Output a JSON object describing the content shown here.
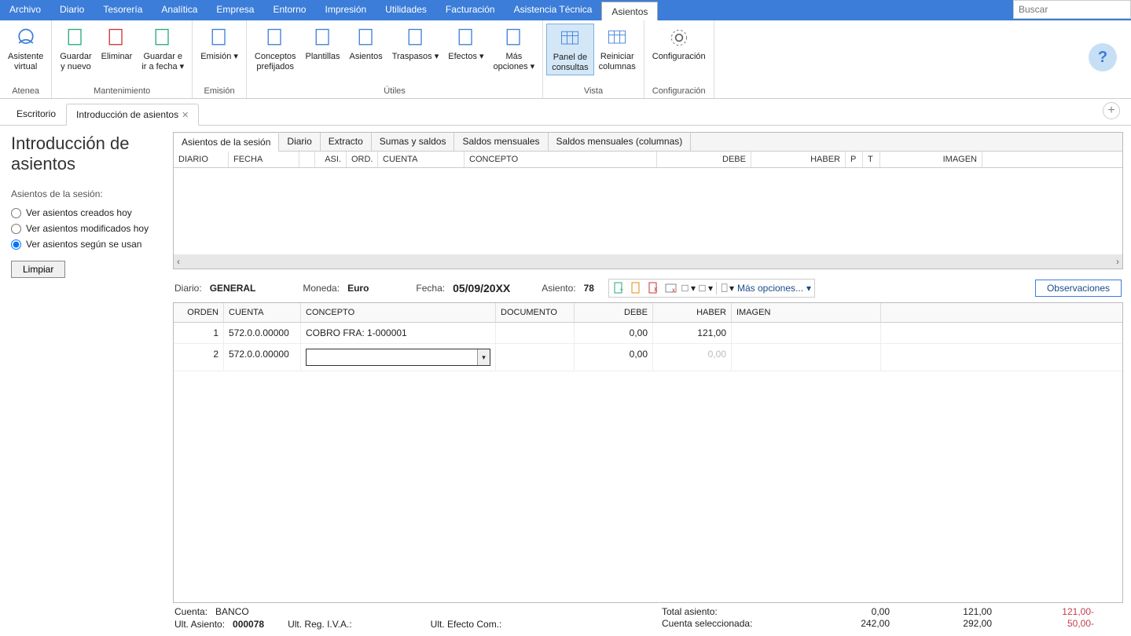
{
  "menubar": {
    "items": [
      "Archivo",
      "Diario",
      "Tesorería",
      "Analítica",
      "Empresa",
      "Entorno",
      "Impresión",
      "Utilidades",
      "Facturación",
      "Asistencia Técnica",
      "Asientos"
    ],
    "active_index": 10
  },
  "search": {
    "placeholder": "Buscar"
  },
  "ribbon": {
    "groups": [
      {
        "title": "Atenea",
        "buttons": [
          {
            "label": "Asistente\nvirtual",
            "name": "asistente-virtual-button"
          }
        ]
      },
      {
        "title": "Mantenimiento",
        "buttons": [
          {
            "label": "Guardar\ny nuevo",
            "name": "guardar-nuevo-button"
          },
          {
            "label": "Eliminar",
            "name": "eliminar-button"
          },
          {
            "label": "Guardar e\nir a fecha",
            "name": "guardar-ir-fecha-button",
            "dropdown": true
          }
        ]
      },
      {
        "title": "Emisión",
        "buttons": [
          {
            "label": "Emisión",
            "name": "emision-button",
            "dropdown": true
          }
        ]
      },
      {
        "title": "Útiles",
        "buttons": [
          {
            "label": "Conceptos\nprefijados",
            "name": "conceptos-prefijados-button"
          },
          {
            "label": "Plantillas",
            "name": "plantillas-button"
          },
          {
            "label": "Asientos",
            "name": "asientos-util-button"
          },
          {
            "label": "Traspasos",
            "name": "traspasos-button",
            "dropdown": true
          },
          {
            "label": "Efectos",
            "name": "efectos-button",
            "dropdown": true
          },
          {
            "label": "Más\nopciones",
            "name": "mas-opciones-ribbon-button",
            "dropdown": true
          }
        ]
      },
      {
        "title": "Vista",
        "buttons": [
          {
            "label": "Panel de\nconsultas",
            "name": "panel-consultas-button",
            "active": true
          },
          {
            "label": "Reiniciar\ncolumnas",
            "name": "reiniciar-columnas-button"
          }
        ]
      },
      {
        "title": "Configuración",
        "buttons": [
          {
            "label": "Configuración",
            "name": "configuracion-button"
          }
        ]
      }
    ]
  },
  "tabs": {
    "items": [
      {
        "label": "Escritorio",
        "closable": false
      },
      {
        "label": "Introducción de asientos",
        "closable": true,
        "active": true
      }
    ]
  },
  "page": {
    "title": "Introducción de asientos"
  },
  "sidebar": {
    "section_title": "Asientos de la sesión:",
    "radios": [
      {
        "label": "Ver asientos creados hoy",
        "checked": false
      },
      {
        "label": "Ver asientos modificados hoy",
        "checked": false
      },
      {
        "label": "Ver asientos según se usan",
        "checked": true
      }
    ],
    "limpiar_label": "Limpiar"
  },
  "upper_panel": {
    "subtabs": [
      "Asientos de la sesión",
      "Diario",
      "Extracto",
      "Sumas y saldos",
      "Saldos mensuales",
      "Saldos mensuales (columnas)"
    ],
    "active_index": 0,
    "columns": [
      "DIARIO",
      "FECHA",
      "",
      "ASI.",
      "ORD.",
      "CUENTA",
      "CONCEPTO",
      "DEBE",
      "HABER",
      "P",
      "T",
      "IMAGEN"
    ]
  },
  "entry_bar": {
    "diario_label": "Diario:",
    "diario_value": "GENERAL",
    "moneda_label": "Moneda:",
    "moneda_value": "Euro",
    "fecha_label": "Fecha:",
    "fecha_value": "05/09/20XX",
    "asiento_label": "Asiento:",
    "asiento_value": "78",
    "mas_opciones_label": "Más opciones...",
    "observaciones_label": "Observaciones"
  },
  "entry_grid": {
    "columns": [
      "ORDEN",
      "CUENTA",
      "CONCEPTO",
      "DOCUMENTO",
      "DEBE",
      "HABER",
      "IMAGEN"
    ],
    "rows": [
      {
        "orden": "1",
        "cuenta": "572.0.0.00000",
        "concepto": "COBRO FRA: 1-000001",
        "documento": "",
        "debe": "0,00",
        "haber": "121,00",
        "editing": false
      },
      {
        "orden": "2",
        "cuenta": "572.0.0.00000",
        "concepto": "",
        "documento": "",
        "debe": "0,00",
        "haber": "0,00",
        "editing": true,
        "haber_dim": true
      }
    ]
  },
  "footer": {
    "cuenta_label": "Cuenta:",
    "cuenta_value": "BANCO",
    "ult_asiento_label": "Ult. Asiento:",
    "ult_asiento_value": "000078",
    "ult_reg_iva_label": "Ult. Reg. I.V.A.:",
    "ult_efecto_label": "Ult. Efecto Com.:",
    "total_asiento_label": "Total asiento:",
    "cuenta_sel_label": "Cuenta seleccionada:",
    "r1_c1": "0,00",
    "r1_c2": "121,00",
    "r1_c3": "121,00-",
    "r2_c1": "242,00",
    "r2_c2": "292,00",
    "r2_c3": "50,00-"
  }
}
